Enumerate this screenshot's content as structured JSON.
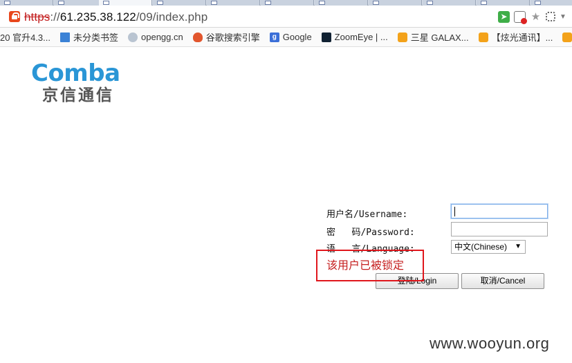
{
  "browser": {
    "url_scheme": "https",
    "url_sep": "://",
    "url_host": "61.235.38.122",
    "url_path": "/09/index.php"
  },
  "bookmarks": [
    {
      "label": "20 官升4.3...",
      "icon": "none"
    },
    {
      "label": "未分类书签",
      "icon": "folder-icon"
    },
    {
      "label": "opengg.cn",
      "icon": "site-icon"
    },
    {
      "label": "谷歌搜索引擎",
      "icon": "fire-icon"
    },
    {
      "label": "Google",
      "icon": "google-icon"
    },
    {
      "label": "ZoomEye | ...",
      "icon": "zoomeye-icon"
    },
    {
      "label": "三星 GALAX...",
      "icon": "orange-icon"
    },
    {
      "label": "【炫光通讯】...",
      "icon": "orange-icon"
    }
  ],
  "logo": {
    "en": "Comba",
    "cn": "京信通信"
  },
  "login": {
    "username_label": "用户名/Username:",
    "password_label": "密   码/Password:",
    "language_label": "语   言/Language:",
    "username_value": "",
    "password_value": "",
    "language_value": "中文(Chinese)",
    "error_message": "该用户已被锁定",
    "login_button": "登陆/Login",
    "cancel_button": "取消/Cancel"
  },
  "watermark": "www.wooyun.org",
  "colors": {
    "logo_blue": "#2a96d6",
    "error_red": "#c51f1f",
    "highlight_red": "#e0161c"
  }
}
